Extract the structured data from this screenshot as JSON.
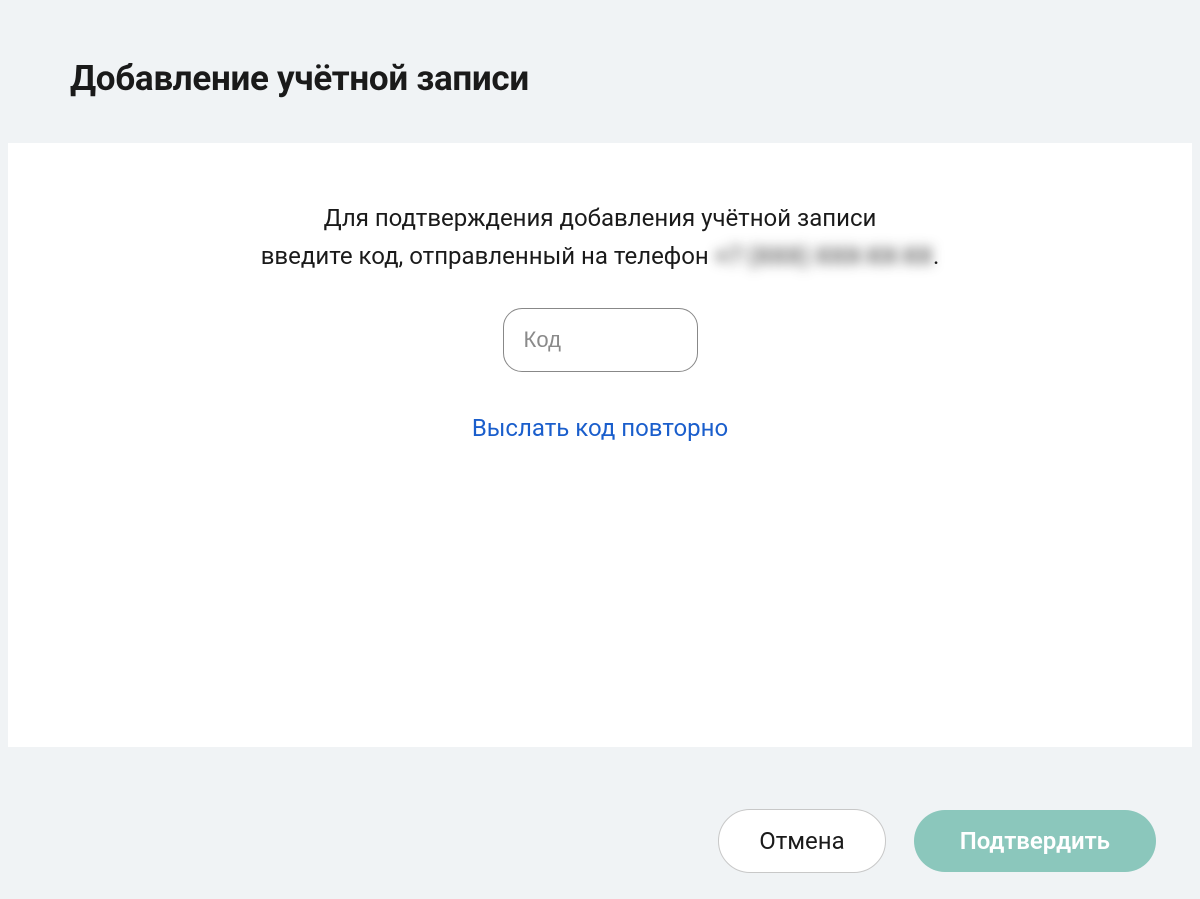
{
  "header": {
    "title": "Добавление учётной записи"
  },
  "content": {
    "description_line1": "Для подтверждения добавления учётной записи",
    "description_line2_prefix": "введите код, отправленный на телефон ",
    "phone_masked": "+7 (XXX) XXX-XX-XX",
    "description_line2_suffix": ".",
    "code_placeholder": "Код",
    "resend_label": "Выслать код повторно"
  },
  "footer": {
    "cancel_label": "Отмена",
    "confirm_label": "Подтвердить"
  }
}
